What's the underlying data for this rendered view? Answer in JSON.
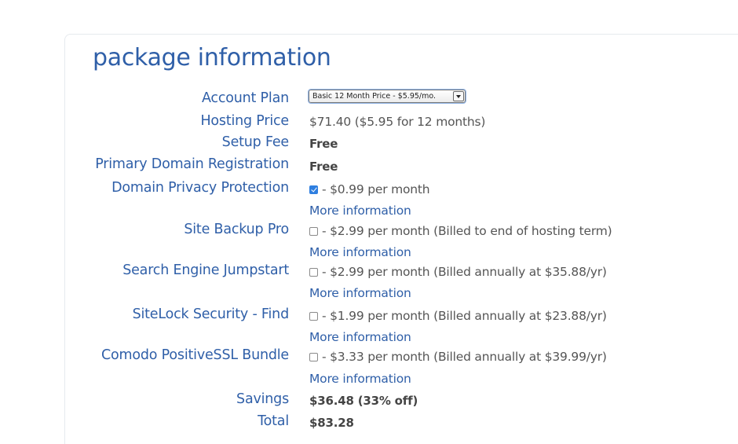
{
  "title": "package information",
  "account_plan": {
    "label": "Account Plan",
    "selected": "Basic 12 Month Price - $5.95/mo."
  },
  "hosting_price": {
    "label": "Hosting Price",
    "value": "$71.40  ($5.95 for 12 months)"
  },
  "setup_fee": {
    "label": "Setup Fee",
    "value": "Free"
  },
  "primary_domain": {
    "label": "Primary Domain Registration",
    "value": "Free"
  },
  "addons": [
    {
      "label": "Domain Privacy Protection",
      "checked": true,
      "text": "- $0.99 per month",
      "more": "More information"
    },
    {
      "label": "Site Backup Pro",
      "checked": false,
      "text": "- $2.99 per month (Billed to end of hosting term)",
      "more": "More information"
    },
    {
      "label": "Search Engine Jumpstart",
      "checked": false,
      "text": "- $2.99 per month (Billed annually at $35.88/yr)",
      "more": "More information"
    },
    {
      "label": "SiteLock Security - Find",
      "checked": false,
      "text": "- $1.99 per month (Billed annually at $23.88/yr)",
      "more": "More information"
    },
    {
      "label": "Comodo PositiveSSL Bundle",
      "checked": false,
      "text": "- $3.33 per month (Billed annually at $39.99/yr)",
      "more": "More information"
    }
  ],
  "savings": {
    "label": "Savings",
    "value": "$36.48 (33% off)"
  },
  "total": {
    "label": "Total",
    "value": "$83.28"
  },
  "colors": {
    "label_blue": "#2f5fa8",
    "value_gray": "#555555",
    "checkbox_blue": "#2f7fe0"
  }
}
